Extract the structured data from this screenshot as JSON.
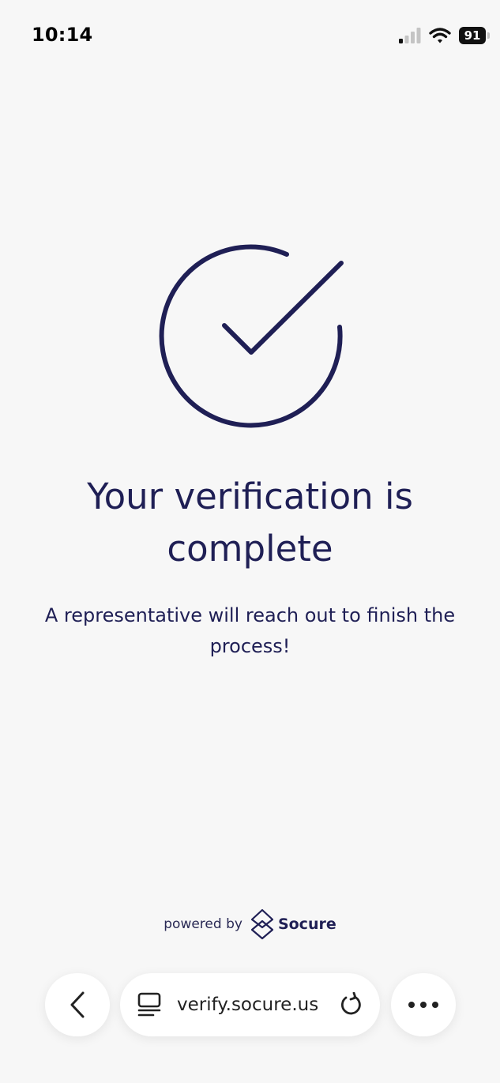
{
  "status_bar": {
    "time": "10:14",
    "battery_level": "91",
    "icons": [
      "signal-icon",
      "wifi-icon",
      "battery-icon"
    ]
  },
  "main": {
    "icon": "check-circle-icon",
    "title": "Your verification is complete",
    "message": "A representative will reach out to finish the process!"
  },
  "footer": {
    "powered_by_label": "powered by",
    "brand_name": "Socure",
    "brand_icon": "socure-logo-icon"
  },
  "browser_toolbar": {
    "url": "verify.socure.us",
    "back_icon": "chevron-left-icon",
    "tabs_icon": "tabs-icon",
    "reload_icon": "reload-icon",
    "more_icon": "more-icon"
  },
  "colors": {
    "background": "#f7f7f7",
    "primary": "#1f1f55"
  }
}
